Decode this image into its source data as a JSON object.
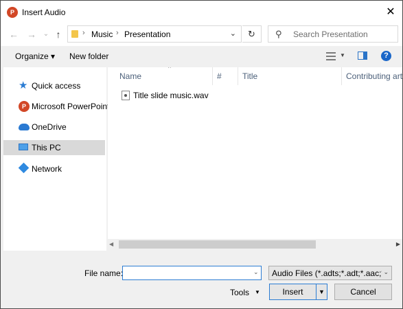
{
  "window": {
    "title": "Insert Audio",
    "app_icon_letter": "P",
    "close_glyph": "✕"
  },
  "nav": {
    "back_glyph": "←",
    "forward_glyph": "→",
    "recent_glyph": "⌄",
    "up_glyph": "↑",
    "breadcrumb": [
      "Music",
      "Presentation"
    ],
    "refresh_glyph": "↻",
    "search_placeholder": "Search Presentation"
  },
  "toolbar": {
    "organize_label": "Organize ▾",
    "new_folder_label": "New folder",
    "help_glyph": "?"
  },
  "sidebar": {
    "items": [
      {
        "label": "Quick access",
        "icon": "star-icon",
        "selected": false
      },
      {
        "label": "Microsoft PowerPoint",
        "icon": "powerpoint-icon",
        "selected": false
      },
      {
        "label": "OneDrive",
        "icon": "cloud-icon",
        "selected": false
      },
      {
        "label": "This PC",
        "icon": "computer-icon",
        "selected": true
      },
      {
        "label": "Network",
        "icon": "network-icon",
        "selected": false
      }
    ]
  },
  "columns": [
    "Name",
    "#",
    "Title",
    "Contributing arti"
  ],
  "files": [
    {
      "name": "Title slide music.wav",
      "icon": "audio-file-icon"
    }
  ],
  "footer": {
    "file_name_label": "File name:",
    "file_name_value": "",
    "file_type_label": "Audio Files (*.adts;*.adt;*.aac;*.ai",
    "tools_label": "Tools",
    "insert_label": "Insert",
    "cancel_label": "Cancel"
  },
  "colors": {
    "accent": "#2b7cd3",
    "selection": "#d9d9d9",
    "powerpoint": "#d24726"
  }
}
